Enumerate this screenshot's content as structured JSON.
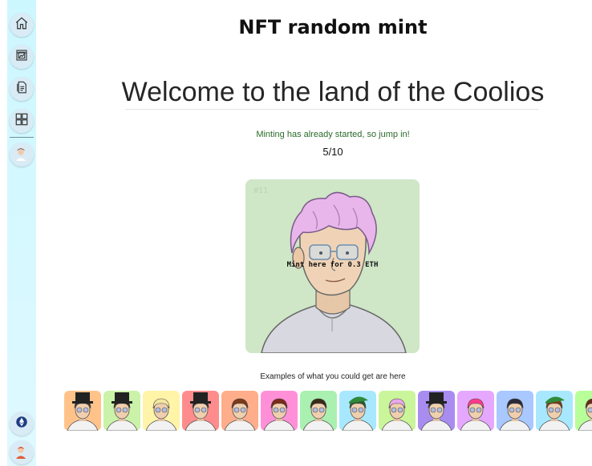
{
  "page": {
    "title": "NFT random mint",
    "welcome": "Welcome to the land of the Coolios",
    "status": "Minting has already started, so jump in!",
    "progress": "5/10",
    "examples_label": "Examples of what you could get are here"
  },
  "mint_card": {
    "nft_id": "#11",
    "mint_label": "Mint here for 0.3 ETH",
    "background": "#cfe6c7",
    "hair_color": "#e8b6ea"
  },
  "sidebar": {
    "items": [
      {
        "icon": "home-icon"
      },
      {
        "icon": "gallery-icon"
      },
      {
        "icon": "documents-icon"
      },
      {
        "icon": "dashboard-grid-icon"
      },
      {
        "icon": "avatar-icon"
      }
    ],
    "bottom": [
      {
        "icon": "ethereum-icon"
      },
      {
        "icon": "user-avatar-icon"
      }
    ]
  },
  "examples": [
    {
      "bg": "#ffc38a",
      "hair": "#3a3a3a",
      "hat": "top-hat"
    },
    {
      "bg": "#caf2a8",
      "hair": "#3a2a1a",
      "hat": "top-hat"
    },
    {
      "bg": "#fff4a8",
      "hair": "#f2e6a0",
      "hat": "none"
    },
    {
      "bg": "#ff8c8c",
      "hair": "#2a2a2a",
      "hat": "top-hat"
    },
    {
      "bg": "#ffad8a",
      "hair": "#7a3a1a",
      "hat": "none"
    },
    {
      "bg": "#ff90d8",
      "hair": "#7a2a1a",
      "hat": "none"
    },
    {
      "bg": "#aaf0b0",
      "hair": "#3a2a1a",
      "hat": "none"
    },
    {
      "bg": "#a8e8ff",
      "hair": "#2a5a2a",
      "hat": "green-cap"
    },
    {
      "bg": "#caf59a",
      "hair": "#e8a8e8",
      "hat": "none"
    },
    {
      "bg": "#a88cf0",
      "hair": "#2a2a2a",
      "hat": "top-hat"
    },
    {
      "bg": "#e6a8ff",
      "hair": "#ff3a8c",
      "hat": "none"
    },
    {
      "bg": "#a8c8ff",
      "hair": "#2a2a3a",
      "hat": "none"
    },
    {
      "bg": "#a8e8ff",
      "hair": "#7a3a1a",
      "hat": "green-cap"
    },
    {
      "bg": "#b8ff9a",
      "hair": "#6a2a1a",
      "hat": "none"
    }
  ]
}
